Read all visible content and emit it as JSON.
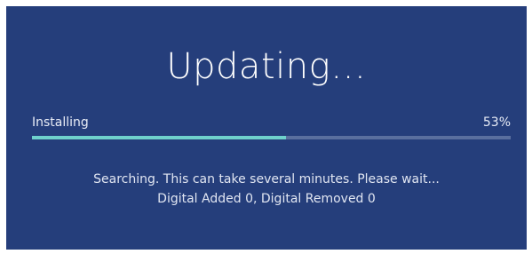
{
  "dialog": {
    "title": "Updating…",
    "status_label": "Installing",
    "progress_text": "53%",
    "progress_fraction": 0.53,
    "message_line1": "Searching. This can take several minutes. Please wait...",
    "message_line2": "Digital Added 0, Digital Removed 0"
  },
  "colors": {
    "panel_background": "#253e7b",
    "progress_fill": "#6fd1cc",
    "progress_track": "#5a6f9e",
    "text": "#ffffff"
  }
}
